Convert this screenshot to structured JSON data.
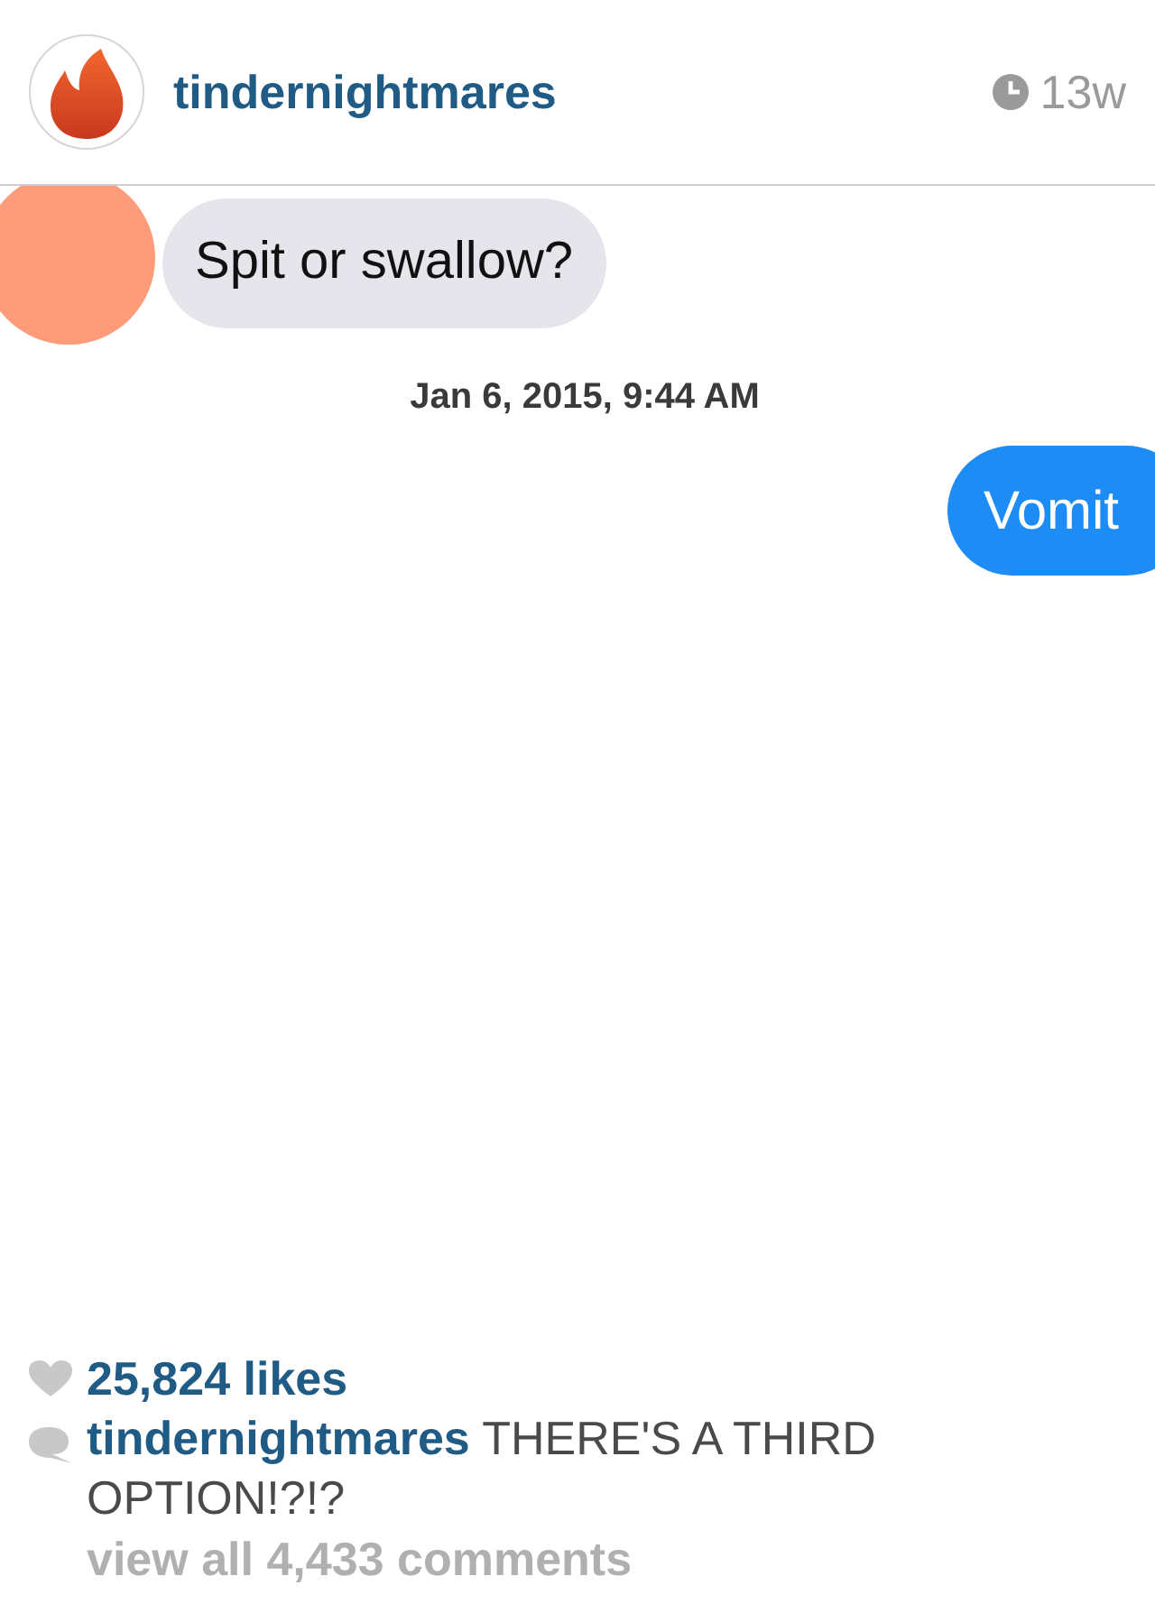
{
  "header": {
    "username": "tindernightmares",
    "age": "13w"
  },
  "conversation": [
    {
      "kind": "incoming",
      "text": "Spit or swallow?"
    },
    {
      "kind": "timestamp",
      "text": "Jan 6, 2015, 9:44 AM"
    },
    {
      "kind": "outgoing",
      "text": "Vomit"
    }
  ],
  "likes": "25,824 likes",
  "caption": {
    "username": "tindernightmares",
    "text": "THERE'S A THIRD OPTION!?!?"
  },
  "view_comments": "view all 4,433 comments"
}
